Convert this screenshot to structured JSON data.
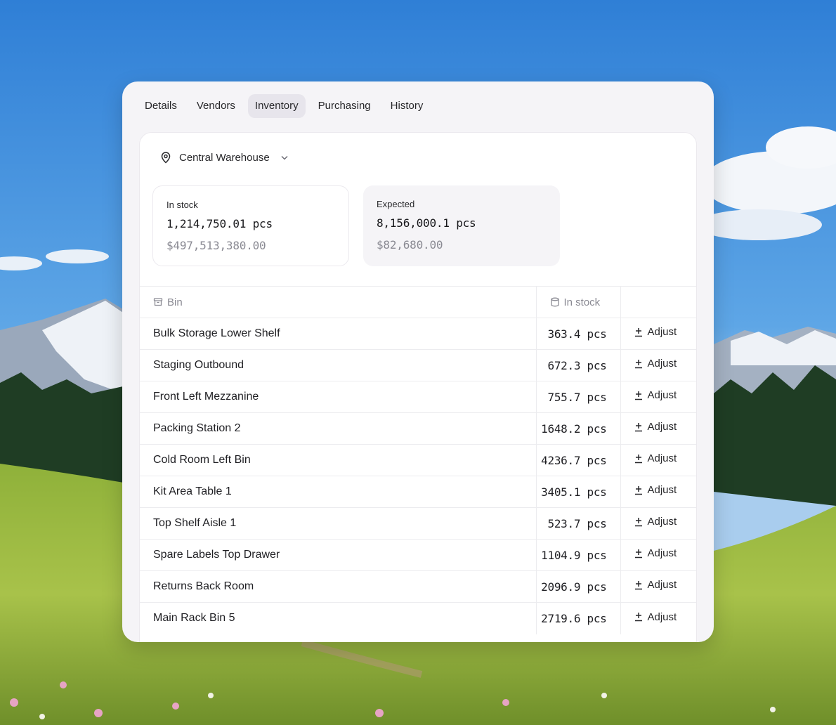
{
  "tabs": [
    {
      "label": "Details"
    },
    {
      "label": "Vendors"
    },
    {
      "label": "Inventory"
    },
    {
      "label": "Purchasing"
    },
    {
      "label": "History"
    }
  ],
  "active_tab": "Inventory",
  "location": {
    "name": "Central Warehouse"
  },
  "stats": {
    "in_stock": {
      "label": "In stock",
      "quantity": "1,214,750.01 pcs",
      "value": "$497,513,380.00"
    },
    "expected": {
      "label": "Expected",
      "quantity": "8,156,000.1 pcs",
      "value": "$82,680.00"
    }
  },
  "table": {
    "headers": {
      "bin": "Bin",
      "in_stock": "In stock"
    },
    "action_label": "Adjust",
    "rows": [
      {
        "bin": "Bulk Storage Lower Shelf",
        "stock": "363.4 pcs"
      },
      {
        "bin": "Staging Outbound",
        "stock": "672.3 pcs"
      },
      {
        "bin": "Front Left Mezzanine",
        "stock": "755.7 pcs"
      },
      {
        "bin": "Packing Station 2",
        "stock": "1648.2 pcs"
      },
      {
        "bin": "Cold Room Left Bin",
        "stock": "4236.7 pcs"
      },
      {
        "bin": "Kit Area Table 1",
        "stock": "3405.1 pcs"
      },
      {
        "bin": "Top Shelf Aisle 1",
        "stock": "523.7 pcs"
      },
      {
        "bin": "Spare Labels Top Drawer",
        "stock": "1104.9 pcs"
      },
      {
        "bin": "Returns Back Room",
        "stock": "2096.9 pcs"
      },
      {
        "bin": "Main Rack Bin 5",
        "stock": "2719.6 pcs"
      }
    ]
  },
  "icons": {
    "location": "map-pin-icon",
    "dropdown": "chevron-down-icon",
    "bin_header": "archive-box-icon",
    "stock_header": "cylinder-icon",
    "adjust": "plus-minus-icon"
  },
  "colors": {
    "card_background": "#f5f4f7",
    "panel_background": "#ffffff",
    "active_tab_background": "#e7e5ec",
    "muted_text": "#8a8a93"
  }
}
